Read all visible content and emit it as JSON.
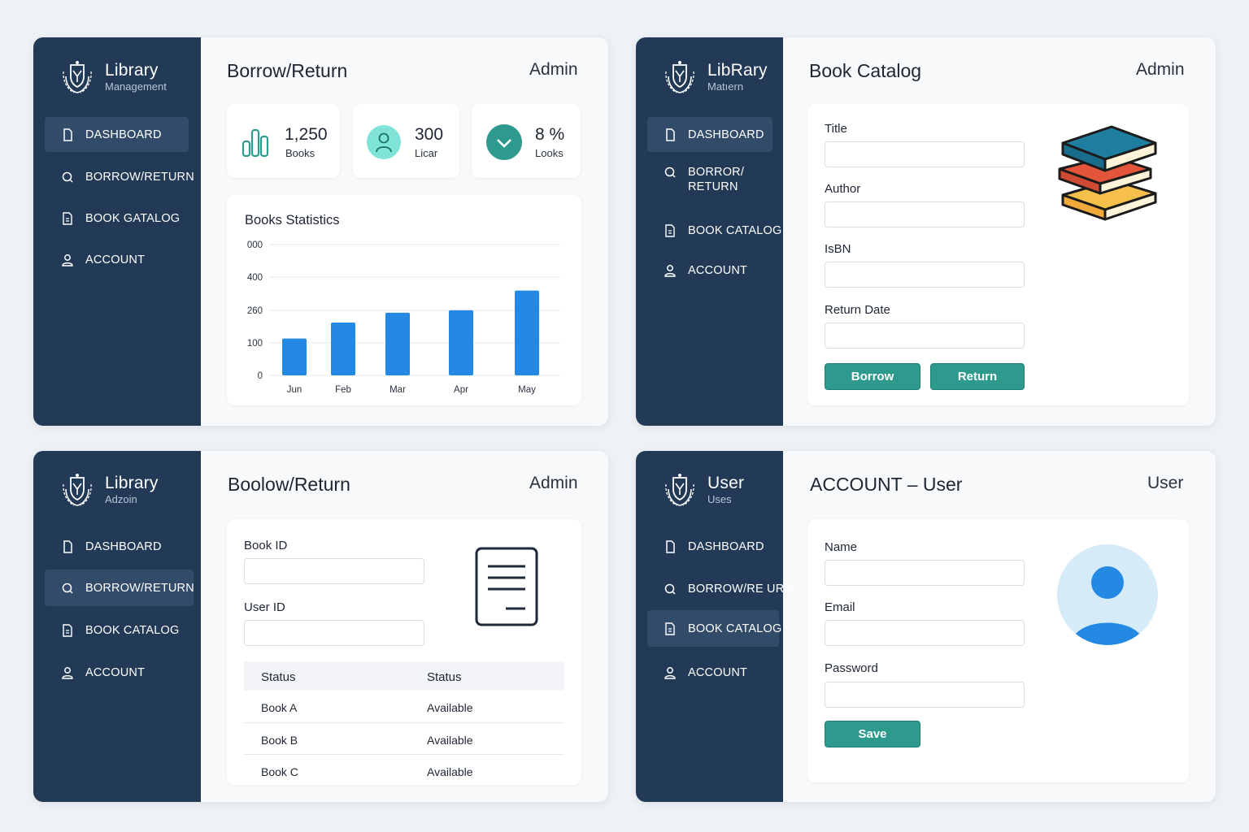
{
  "colors": {
    "sidebar": "#223a56",
    "bar": "#2389e3",
    "accent": "#2e9a8d"
  },
  "panels": [
    {
      "brand": {
        "title": "Library",
        "subtitle": "Management"
      },
      "nav": [
        {
          "label": "DASHBOARD",
          "icon": "page-icon"
        },
        {
          "label": "BORROW/RETURN",
          "icon": "search-icon"
        },
        {
          "label": "BOOK GATALOG",
          "icon": "document-icon"
        },
        {
          "label": "ACCOUNT",
          "icon": "user-icon"
        }
      ],
      "title": "Borrow/Return",
      "role": "Admin",
      "stats": [
        {
          "value": "1,250",
          "label": "Books",
          "icon": "bar-chart-icon"
        },
        {
          "value": "300",
          "label": "Licar",
          "icon": "user-avatar-icon"
        },
        {
          "value": "8 %",
          "label": "Looks",
          "icon": "check-circle-icon"
        }
      ]
    },
    {
      "brand": {
        "title": "LibRary",
        "subtitle": "Matıern"
      },
      "nav": [
        {
          "label": "DASHBOARD",
          "icon": "page-icon"
        },
        {
          "label": "BORROR/",
          "label2": "RETURN",
          "icon": "search-icon"
        },
        {
          "label": "BOOK CATALOG",
          "icon": "document-icon"
        },
        {
          "label": "ACCOUNT",
          "icon": "user-icon"
        }
      ],
      "title": "Book Catalog",
      "role": "Admin",
      "form": {
        "title_label": "Title",
        "author_label": "Author",
        "isbn_label": "IsBN",
        "return_label": "Return Date",
        "borrow_btn": "Borrow",
        "return_btn": "Return"
      }
    },
    {
      "brand": {
        "title": "Library",
        "subtitle": "Adzoin"
      },
      "nav": [
        {
          "label": "DASHBOARD",
          "icon": "page-icon"
        },
        {
          "label": "BORROW/RETURN",
          "icon": "search-icon"
        },
        {
          "label": "BOOK CATALOG",
          "icon": "document-icon"
        },
        {
          "label": "ACCOUNT",
          "icon": "user-icon"
        }
      ],
      "title": "Boolow/Return",
      "role": "Admin",
      "form": {
        "book_id_label": "Book ID",
        "user_id_label": "User ID"
      },
      "table": {
        "headers": [
          "Status",
          "Status"
        ],
        "rows": [
          [
            "Book A",
            "Available"
          ],
          [
            "Book B",
            "Available"
          ],
          [
            "Book C",
            "Available"
          ]
        ]
      }
    },
    {
      "brand": {
        "title": "User",
        "subtitle": "Uses"
      },
      "nav": [
        {
          "label": "DASHBOARD",
          "icon": "page-icon"
        },
        {
          "label": "BORROW/RE URN",
          "icon": "search-icon"
        },
        {
          "label": "BOOK CATALOG",
          "icon": "document-icon"
        },
        {
          "label": "ACCOUNT",
          "icon": "user-icon"
        }
      ],
      "title": "ACCOUNT",
      "title_sep": " – ",
      "title_suffix": "User",
      "role": "User",
      "form": {
        "name_label": "Name",
        "email_label": "Email",
        "password_label": "Password",
        "save_btn": "Save"
      }
    }
  ],
  "chart_data": {
    "type": "bar",
    "title": "Books Statistics",
    "categories": [
      "Jun",
      "Feb",
      "Mar",
      "Apr",
      "May"
    ],
    "values": [
      150,
      215,
      255,
      265,
      345
    ],
    "yticks": [
      0,
      100,
      260,
      400,
      "000"
    ],
    "ylim": [
      0,
      400
    ],
    "grid": true
  }
}
